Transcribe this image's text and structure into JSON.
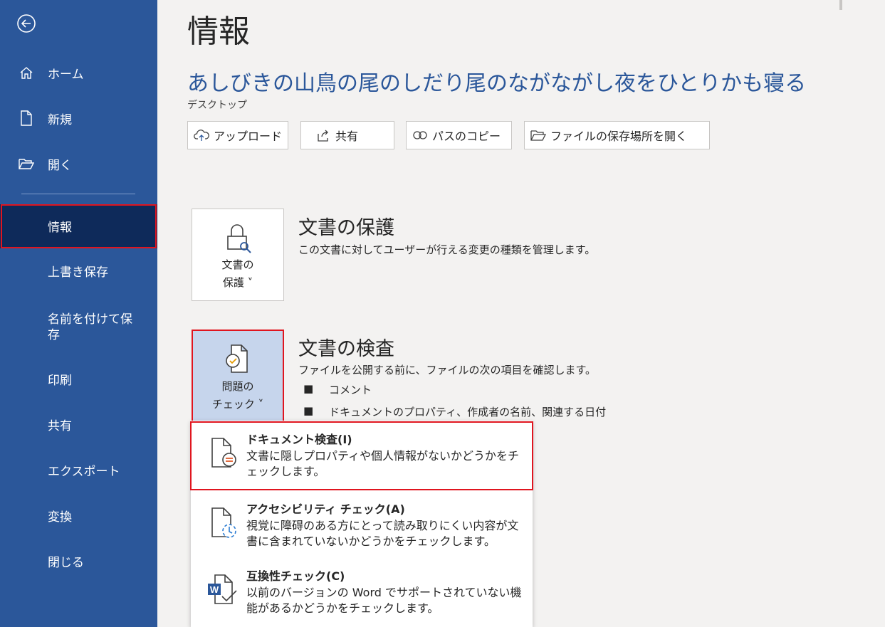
{
  "sidebar": {
    "top_items": [
      {
        "label": "ホーム",
        "icon": "home-icon"
      },
      {
        "label": "新規",
        "icon": "new-document-icon"
      },
      {
        "label": "開く",
        "icon": "open-folder-icon"
      }
    ],
    "sub_items": [
      {
        "label": "情報",
        "selected": true
      },
      {
        "label": "上書き保存"
      },
      {
        "label": "名前を付けて保存"
      },
      {
        "label": "印刷"
      },
      {
        "label": "共有"
      },
      {
        "label": "エクスポート"
      },
      {
        "label": "変換"
      },
      {
        "label": "閉じる"
      }
    ]
  },
  "main": {
    "page_title": "情報",
    "doc_title": "あしびきの山鳥の尾のしだり尾のながながし夜をひとりかも寝る",
    "doc_location": "デスクトップ",
    "actions": [
      {
        "label": "アップロード",
        "icon": "upload-cloud-icon"
      },
      {
        "label": "共有",
        "icon": "share-icon"
      },
      {
        "label": "パスのコピー",
        "icon": "copy-link-icon"
      },
      {
        "label": "ファイルの保存場所を開く",
        "icon": "folder-open-icon"
      }
    ],
    "protect": {
      "button_line1": "文書の",
      "button_line2": "保護 ˅",
      "title": "文書の保護",
      "desc": "この文書に対してユーザーが行える変更の種類を管理します。"
    },
    "inspect": {
      "button_line1": "問題の",
      "button_line2": "チェック ˅",
      "title": "文書の検査",
      "desc": "ファイルを公開する前に、ファイルの次の項目を確認します。",
      "bullets": [
        "コメント",
        "ドキュメントのプロパティ、作成者の名前、関連する日付"
      ]
    },
    "dropdown": [
      {
        "title": "ドキュメント検査(I)",
        "desc": "文書に隠しプロパティや個人情報がないかどうかをチェックします。",
        "icon": "inspect-document-icon"
      },
      {
        "title": "アクセシビリティ チェック(A)",
        "desc": "視覚に障碍のある方にとって読み取りにくい内容が文書に含まれていないかどうかをチェックします。",
        "icon": "accessibility-check-icon"
      },
      {
        "title": "互換性チェック(C)",
        "desc": "以前のバージョンの Word でサポートされていない機能があるかどうかをチェックします。",
        "icon": "compatibility-check-icon"
      }
    ]
  },
  "colors": {
    "sidebar": "#2b579a",
    "sidebar_selected": "#0e2a5a",
    "highlight": "#e0151f",
    "title_blue": "#2b579a"
  }
}
